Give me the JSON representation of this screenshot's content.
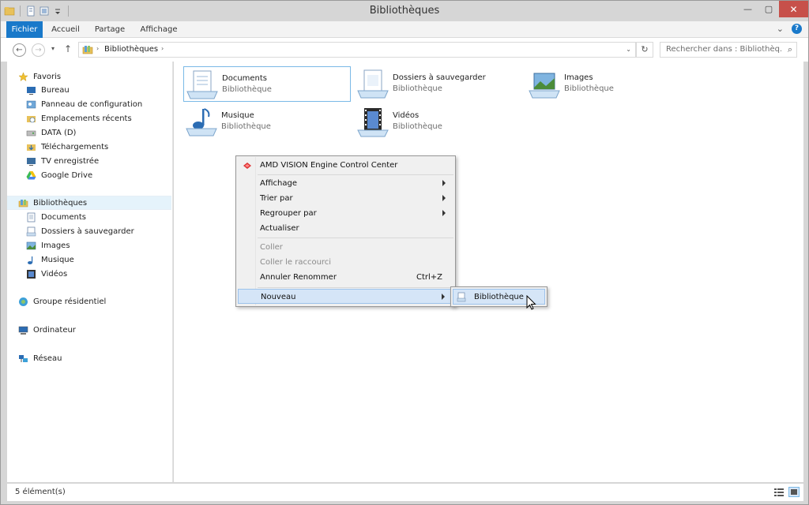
{
  "window": {
    "title": "Bibliothèques",
    "minimize": "—",
    "maximize": "▢",
    "close": "✕"
  },
  "ribbon": {
    "tabs": [
      "Fichier",
      "Accueil",
      "Partage",
      "Affichage"
    ],
    "expand": "⌄",
    "help": "?"
  },
  "address": {
    "back": "←",
    "forward": "→",
    "history": "▾",
    "up": "↑",
    "arrow": "›",
    "path": "Bibliothèques",
    "dropdown": "⌄",
    "refresh": "↻",
    "search_placeholder": "Rechercher dans : Bibliothèq...",
    "search_icon": "⌕"
  },
  "navigation": {
    "favorites_label": "Favoris",
    "favorites": [
      "Bureau",
      "Panneau de configuration",
      "Emplacements récents",
      "DATA (D)",
      "Téléchargements",
      "TV enregistrée",
      "Google Drive"
    ],
    "libraries_label": "Bibliothèques",
    "libraries": [
      "Documents",
      "Dossiers à sauvegarder",
      "Images",
      "Musique",
      "Vidéos"
    ],
    "homegroup": "Groupe résidentiel",
    "computer": "Ordinateur",
    "network": "Réseau"
  },
  "libraries": [
    {
      "name": "Documents",
      "type": "Bibliothèque",
      "icon": "documents-library-icon"
    },
    {
      "name": "Dossiers à sauvegarder",
      "type": "Bibliothèque",
      "icon": "folders-library-icon"
    },
    {
      "name": "Images",
      "type": "Bibliothèque",
      "icon": "pictures-library-icon"
    },
    {
      "name": "Musique",
      "type": "Bibliothèque",
      "icon": "music-library-icon"
    },
    {
      "name": "Vidéos",
      "type": "Bibliothèque",
      "icon": "videos-library-icon"
    }
  ],
  "context_menu": {
    "amd": "AMD  VISION  Engine  Control  Center",
    "view": "Affichage",
    "sort": "Trier par",
    "group": "Regrouper par",
    "refresh": "Actualiser",
    "paste": "Coller",
    "paste_shortcut": "Coller le raccourci",
    "undo": "Annuler Renommer",
    "undo_shortcut": "Ctrl+Z",
    "new": "Nouveau"
  },
  "submenu": {
    "library": "Bibliothèque"
  },
  "status": {
    "count": "5 élément(s)"
  },
  "colors": {
    "accent": "#1979ca",
    "close": "#c7504a",
    "selection": "#d5e5f7"
  }
}
